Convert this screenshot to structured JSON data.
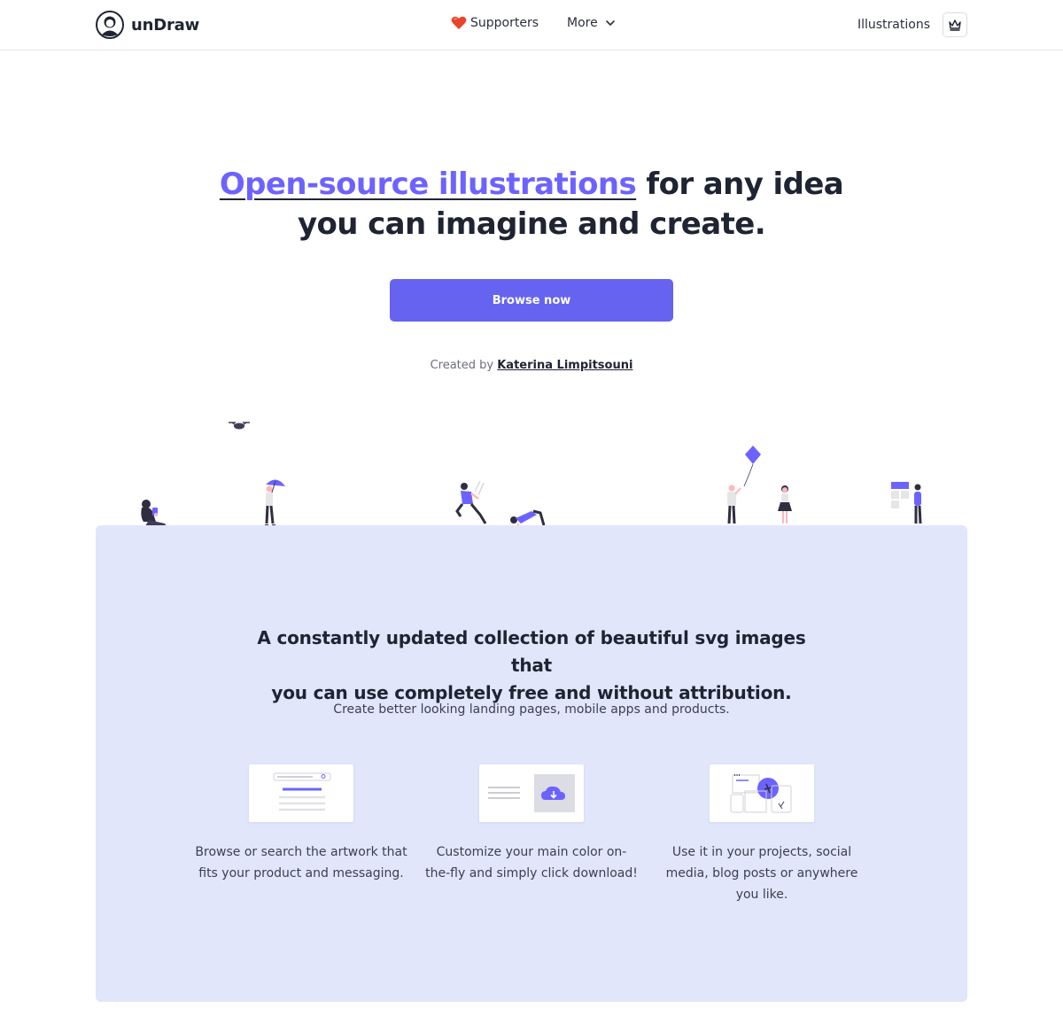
{
  "header": {
    "brand": "unDraw",
    "nav": [
      {
        "label": "Supporters",
        "icon": "heart-icon"
      },
      {
        "label": "More",
        "icon": "chevron-down-icon"
      }
    ],
    "right_link": "Illustrations",
    "crown_icon": "crown-icon"
  },
  "hero": {
    "title_highlight": "Open-source illustrations",
    "title_rest_line1": " for any idea",
    "title_line2": "you can imagine and create.",
    "cta_label": "Browse now",
    "credit_prefix": "Created by ",
    "credit_author": "Katerina Limpitsouni"
  },
  "panel": {
    "title_line1": "A constantly updated collection of beautiful svg images that",
    "title_line2": "you can use completely free and without attribution.",
    "subtitle": "Create better looking landing pages, mobile apps and products.",
    "features": [
      {
        "text": "Browse or search the artwork that fits your product and messaging.",
        "icon": "search-browse-icon"
      },
      {
        "text": "Customize your main color on-the-fly and simply click download!",
        "icon": "cloud-download-icon"
      },
      {
        "text": "Use it in your projects, social media, blog posts or anywhere you like.",
        "icon": "devices-icon"
      }
    ]
  },
  "colors": {
    "accent": "#6c63ff",
    "button": "#6563ef",
    "panel_bg": "#e1e6fb",
    "text_dark": "#1f2433"
  }
}
